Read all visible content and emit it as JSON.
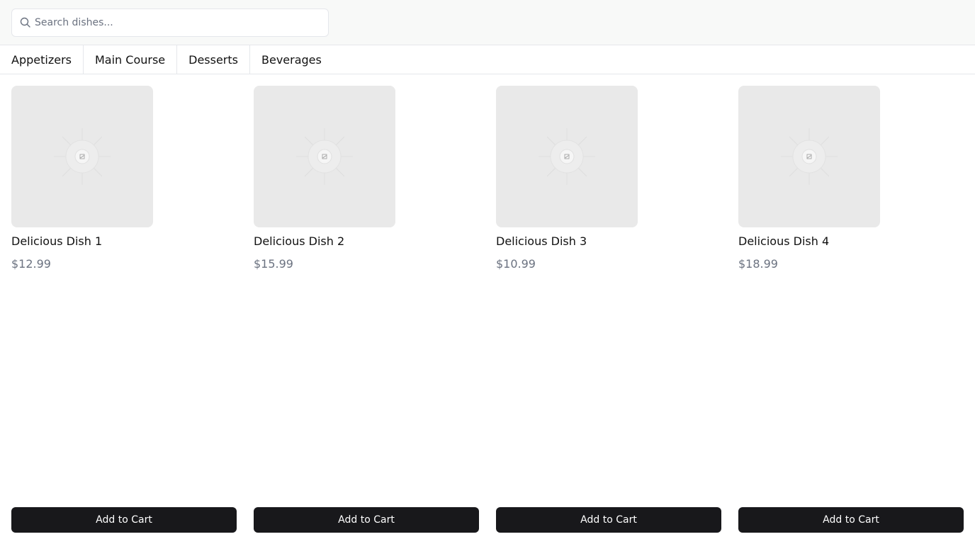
{
  "search": {
    "placeholder": "Search dishes...",
    "value": ""
  },
  "tabs": [
    {
      "label": "Appetizers"
    },
    {
      "label": "Main Course"
    },
    {
      "label": "Desserts"
    },
    {
      "label": "Beverages"
    }
  ],
  "dishes": [
    {
      "name": "Delicious Dish 1",
      "price": "$12.99",
      "button_label": "Add to Cart",
      "image_icon": "image-placeholder-icon"
    },
    {
      "name": "Delicious Dish 2",
      "price": "$15.99",
      "button_label": "Add to Cart",
      "image_icon": "image-placeholder-icon"
    },
    {
      "name": "Delicious Dish 3",
      "price": "$10.99",
      "button_label": "Add to Cart",
      "image_icon": "image-placeholder-icon"
    },
    {
      "name": "Delicious Dish 4",
      "price": "$18.99",
      "button_label": "Add to Cart",
      "image_icon": "image-placeholder-icon"
    }
  ],
  "colors": {
    "topbar_bg": "#f8f9f8",
    "button_bg": "#18181b",
    "price_text": "#6b7280",
    "placeholder_bg": "#e9e9e9"
  },
  "icons": {
    "search": "search-icon"
  }
}
